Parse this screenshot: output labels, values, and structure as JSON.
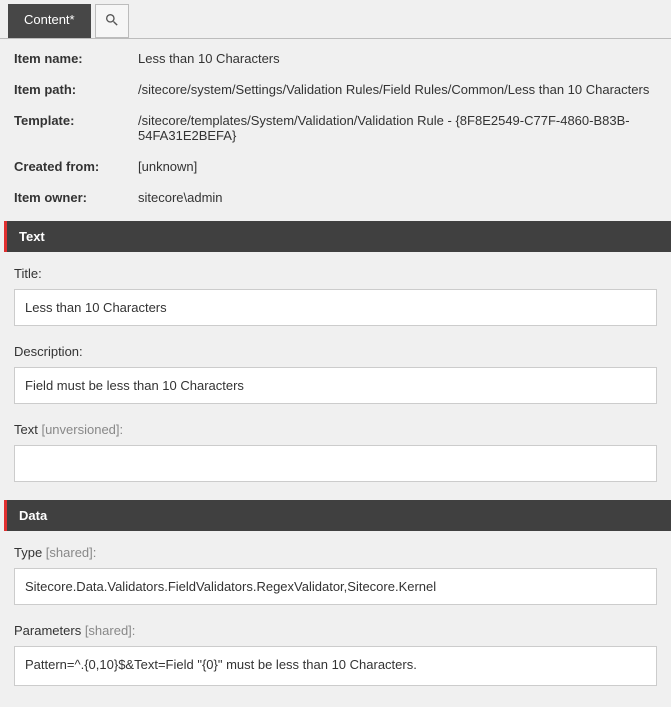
{
  "tabs": {
    "content_label": "Content*"
  },
  "info": {
    "rows": [
      {
        "label": "Item name:",
        "value": "Less than 10 Characters"
      },
      {
        "label": "Item path:",
        "value": "/sitecore/system/Settings/Validation Rules/Field Rules/Common/Less than 10 Characters"
      },
      {
        "label": "Template:",
        "value": "/sitecore/templates/System/Validation/Validation Rule - {8F8E2549-C77F-4860-B83B-54FA31E2BEFA}"
      },
      {
        "label": "Created from:",
        "value": "[unknown]"
      },
      {
        "label": "Item owner:",
        "value": "sitecore\\admin"
      }
    ]
  },
  "sections": {
    "text": {
      "header": "Text",
      "title_label": "Title:",
      "title_value": "Less than 10 Characters",
      "description_label": "Description:",
      "description_value": "Field must be less than 10 Characters",
      "text_label": "Text ",
      "text_suffix": "[unversioned]:",
      "text_value": ""
    },
    "data": {
      "header": "Data",
      "type_label": "Type ",
      "type_suffix": "[shared]:",
      "type_value": "Sitecore.Data.Validators.FieldValidators.RegexValidator,Sitecore.Kernel",
      "parameters_label": "Parameters ",
      "parameters_suffix": "[shared]:",
      "parameters_value": "Pattern=^.{0,10}$&Text=Field \"{0}\" must be less than 10 Characters."
    }
  }
}
